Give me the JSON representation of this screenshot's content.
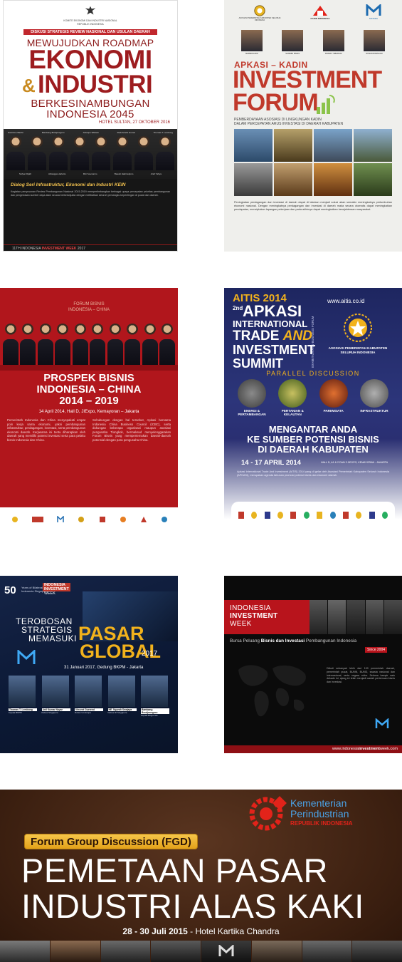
{
  "poster1": {
    "header_org": "KOMITE EKONOMI DAN INDUSTRI NASIONAL\nREPUBLIK INDONESIA",
    "kicker": "DISKUSI STRATEGIS REVIEW NASIONAL DAN USULAN DAERAH",
    "title_line1": "MEWUJUDKAN ROADMAP",
    "title_line2": "EKONOMI",
    "title_amp": "&",
    "title_line3": "INDUSTRI",
    "title_line4": "BERKESINAMBUNGAN",
    "title_line5": "INDONESIA 2045",
    "venue": "HOTEL SULTAN, 27 OKTOBER 2016",
    "speakers_top": [
      "Soetrisno Bachir",
      "Bambang Brodjonegoro",
      "Arkanpo Wahedi",
      "Rudi Artaza Gumai",
      "Thomas T. Lembong"
    ],
    "speakers_bottom": [
      "Sofyan Djalil",
      "Airlangga Hartarto",
      "Rini Soemarno",
      "Basuki Hadimuljono",
      "Arief Yahya"
    ],
    "section_title": "Dialog Seri Infrastruktur, Ekonomi dan Industri KEIN",
    "body": "Kegiatan penyusunan Review Pembangunan Nasional 2015-2019 mempertimbangkan berbagai upaya percepatan prioritas pembangunan dan pengelolaan sumber daya alam secara berkelanjutan dengan melibatkan seluruh pemangku kepentingan di pusat dan daerah.",
    "footer_prefix": "11TH INDONESIA ",
    "footer_bold": "INVESTMENT WEEK",
    "footer_year": " 2017"
  },
  "poster2": {
    "logos": [
      "ASOSIASI PEMERINTAH KABUPATEN SELURUH INDONESIA",
      "KADIN INDONESIA",
      "MATARA"
    ],
    "speakers": [
      "MARWAN ADJI",
      "SANIMIN ISMAIL",
      "FRANKY SIBARANI",
      "ROSAN ROESLANI"
    ],
    "kicker": "APKASI – KADIN",
    "title_line1": "INVESTMENT",
    "title_line2": "FORUM",
    "subtitle": "PEMBERDAYAAN ASOSIASI DI LINGKUNGAN KADIN\nDALAM PERCEPATAN ARUS INVESTASI DI DAERAH KABUPATEN",
    "body": "Peningkatan perdagangan dan investasi di daerah dapat di lakukan menjadi solusi akan semakin meningkatnya pertumbuhan ekonomi nasional. Dengan meningkatnya perdagangan dan investasi di daerah maka secara otomatis dapat meningkatkan pendapatan, menciptakan lapangan pekerjaan dan pada akhirnya dapat meningkatkan kesejahteraan masyarakat."
  },
  "poster3": {
    "kicker": "FORUM BISNIS\nINDONESIA – CHINA",
    "title_line1": "PROSPEK BISNIS",
    "title_line2": "INDONESIA – CHINA",
    "title_line3": "2014 – 2019",
    "date": "14 April 2014, Hall D, JIExpo, Kemayoran – Jakarta",
    "body_left": "Pemerintah Indonesia dan China menyepakati empat poin kerja sama ekonomi, yakni pembangunan infrastruktur, perdagangan, investasi, serta pembangunan ekonomi daerah. Kerjasama ini tentu diharapkan oleh daerah yang memiliki potensi investasi serta para pelaku bisnis Indonesia dan China.",
    "body_right": "Sehubungan dengan hal tersebut, Apkasi bersama Indonesia China Business Council (ICBC), serta dukungan beberapa organisasi maupun asosiasi pengusaha Tiongkok, bermaksud menyelenggarakan Forum Bisnis yang mempertemukan daerah-daerah potensial dengan para pengusaha China."
  },
  "poster4": {
    "title_top": "AITIS 2014",
    "website": "www.aitis.co.id",
    "edition": "2nd",
    "title_line1": "APKASI",
    "title_line2": "INTERNATIONAL",
    "title_line3": "TRADE",
    "title_and": "AND",
    "title_line4": "INVESTMENT",
    "title_line5": "SUMMIT",
    "side_text": "EXHIBITION AND BUSINESS FORUM",
    "org": "ASOSIASI PEMERINTAH KABUPATEN\nSELURUH INDONESIA",
    "parallel": "PARALLEL DISCUSSION",
    "topics": [
      "ENERGI & PERTAMBANGAN",
      "PERTANIAN & KELAUTAN",
      "PARIWISATA",
      "INFRASTRUKTUR"
    ],
    "headline_line1": "MENGANTAR ANDA",
    "headline_line2": "KE SUMBER POTENSI BISNIS",
    "headline_line3": "DI DAERAH KABUPATEN",
    "date_big": "14 - 17 APRIL 2014",
    "date_small": "HALL D, A1 & 2 DAN 3 JIEXPO, KEMAYORAN - JAKARTA",
    "body": "Apkasi International Trade And Investment (AITIS) 2014 yang di gelar oleh Asosiasi Pemerintah Kabupaten Seluruh Indonesia (APKASI), merupakan agenda tahunan promosi potensi bisnis dan ekonomi daerah."
  },
  "poster5": {
    "anniv_num": "50",
    "anniv_text": "Years of Bilateral Indonesia Singapore",
    "badge_line1": "INDONESIA",
    "badge_line2": "INVESTMENT",
    "badge_line3": "WEEK",
    "title_line1": "TEROBOSAN",
    "title_line2": "STRATEGIS",
    "title_line3": "MEMASUKI",
    "title_big1": "PASAR",
    "title_big2": "GLOBAL",
    "title_year": "2017",
    "date": "31 Januari 2017, Gedung BKPM - Jakarta",
    "speakers": [
      {
        "name": "Thomas T. Lembong",
        "role": "Kepala BKPM"
      },
      {
        "name": "Anil Kumar Nayar",
        "role": "Dubes Singapura"
      },
      {
        "name": "Vincent Guerend",
        "role": "Dubes Uni Eropa"
      },
      {
        "name": "HE. Ngurah Swajaya",
        "role": "Dubes RI Singapura"
      },
      {
        "name": "Bambang Brodjonegoro",
        "role": "Kepala Bappenas"
      }
    ]
  },
  "poster6": {
    "title_line1": "INDONESIA",
    "title_line2": "INVESTMENT",
    "title_line3": "WEEK",
    "tagline_pre": "Bursa Peluang ",
    "tagline_bold": "Bisnis dan Investasi",
    "tagline_post": " Pembangunan Indonesia",
    "since": "Since 2004",
    "body": "Diikuti sebanyak lebih dari 100 pemerintah daerah, pemerintah pusat, BUMN, BUMD, swasta nasional dan internasional, serta negara mitra. Selama hampir satu dekade ini, ajang ini telah menjadi wadah pertemuan bisnis dan investasi.",
    "website_pre": "www.indonesia",
    "website_bold": "investment",
    "website_post": "week.com"
  },
  "poster7": {
    "ministry_line1": "Kementerian",
    "ministry_line2": "Perindustrian",
    "ministry_line3": "REPUBLIK INDONESIA",
    "fgd": "Forum Group Discussion (FGD)",
    "title_line1": "PEMETAAN PASAR",
    "title_line2": "INDUSTRI ALAS KAKI",
    "date_bold": "28 - 30 Juli 2015",
    "date_rest": " - Hotel Kartika Chandra"
  },
  "colors": {
    "red": "#b8141c",
    "navy": "#1e2660",
    "gold": "#f2b21c",
    "kadin_red": "#e2231a",
    "brown": "#3b1f10"
  }
}
